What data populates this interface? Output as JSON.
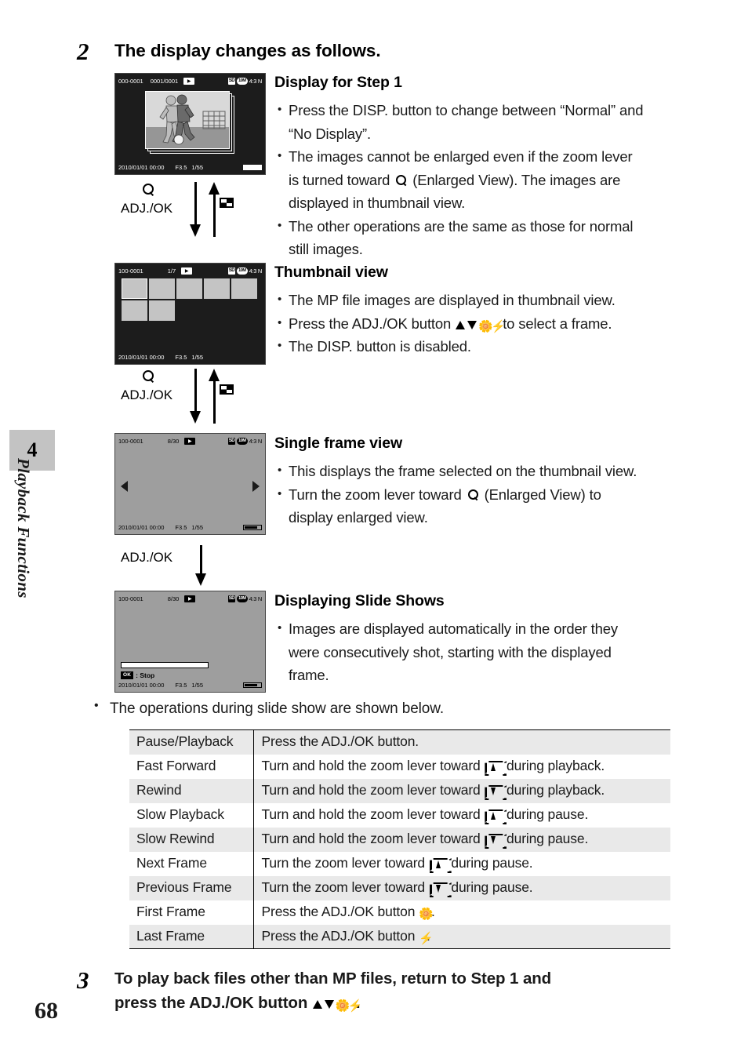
{
  "chapter": {
    "number": "4",
    "label": "Playback Functions",
    "page_number": "68"
  },
  "steps": {
    "step2": {
      "number": "2",
      "title": "The display changes as follows."
    },
    "step3": {
      "number": "3",
      "line1": "To play back files other than MP files, return to Step 1 and",
      "line2_prefix": "press the ADJ./OK button ",
      "line2_suffix": "."
    }
  },
  "screens": {
    "step1_display": {
      "file_no": "000-0001",
      "frame_count": "0001/0001",
      "ratio": "4:3 N",
      "sd_label": "SD",
      "mp_label": "10M",
      "date": "2010/01/01 00:00",
      "aperture": "F3.5",
      "shutter": "1/55"
    },
    "thumbnail": {
      "file_no": "100-0001",
      "frame_count": "1/7",
      "ratio": "4:3 N",
      "sd_label": "SD",
      "mp_label": "10M",
      "date": "2010/01/01 00:00",
      "aperture": "F3.5",
      "shutter": "1/55",
      "thumb_total": 7,
      "selected_index": 0
    },
    "single_frame": {
      "file_no": "100-0001",
      "frame_count": "8/30",
      "ratio": "4:3 N",
      "sd_label": "SD",
      "mp_label": "10M",
      "date": "2010/01/01 00:00",
      "aperture": "F3.5",
      "shutter": "1/55"
    },
    "slide_show": {
      "file_no": "100-0001",
      "frame_count": "8/30",
      "ratio": "4:3 N",
      "sd_label": "SD",
      "mp_label": "10M",
      "date": "2010/01/01 00:00",
      "aperture": "F3.5",
      "shutter": "1/55",
      "ok_key": "OK",
      "stop_label": ": Stop"
    }
  },
  "transitions": {
    "t1": {
      "label": "ADJ./OK"
    },
    "t2": {
      "label": "ADJ./OK"
    },
    "t3": {
      "label": "ADJ./OK"
    }
  },
  "sections": {
    "display_step1": {
      "heading": "Display for Step 1",
      "b1_line1": "Press the DISP. button to change between “Normal” and",
      "b1_line2": "“No Display”.",
      "b2_line1": "The images cannot be enlarged even if the zoom lever",
      "b2_line2_a": "is turned toward ",
      "b2_line2_b": " (Enlarged View). The images are",
      "b2_line3": "displayed in thumbnail view.",
      "b3_line1": "The other operations are the same as those for normal",
      "b3_line2": "still images."
    },
    "thumbnail_view": {
      "heading": "Thumbnail view",
      "b1": "The MP file images are displayed in thumbnail view.",
      "b2_a": "Press the ADJ./OK button ",
      "b2_b": " to select a frame.",
      "b3": "The DISP. button is disabled."
    },
    "single_frame_view": {
      "heading": "Single frame view",
      "b1": "This displays the frame selected on the thumbnail view.",
      "b2_a": "Turn the zoom lever toward ",
      "b2_b": " (Enlarged View) to",
      "b2_line2": "display enlarged view."
    },
    "slide_shows": {
      "heading": "Displaying Slide Shows",
      "b1_line1": "Images are displayed automatically in the order they",
      "b1_line2": "were consecutively shot, starting with the displayed",
      "b1_line3": "frame."
    }
  },
  "operations": {
    "intro": "The operations during slide show are shown below.",
    "rows": [
      {
        "key": "Pause/Playback",
        "before": "Press the ADJ./OK button.",
        "icon": "",
        "after": ""
      },
      {
        "key": "Fast Forward",
        "before": "Turn and hold the zoom lever toward ",
        "icon": "tele",
        "after": " during playback."
      },
      {
        "key": "Rewind",
        "before": "Turn and hold the zoom lever toward ",
        "icon": "wide",
        "after": " during playback."
      },
      {
        "key": "Slow Playback",
        "before": "Turn and hold the zoom lever toward ",
        "icon": "tele",
        "after": " during pause."
      },
      {
        "key": "Slow Rewind",
        "before": "Turn and hold the zoom lever toward ",
        "icon": "wide",
        "after": " during pause."
      },
      {
        "key": "Next Frame",
        "before": "Turn the zoom lever toward ",
        "icon": "tele",
        "after": " during pause."
      },
      {
        "key": "Previous Frame",
        "before": "Turn the zoom lever toward ",
        "icon": "wide",
        "after": " during pause."
      },
      {
        "key": "First Frame",
        "before": "Press the ADJ./OK button ",
        "icon": "macro",
        "after": "."
      },
      {
        "key": "Last Frame",
        "before": "Press the ADJ./OK button ",
        "icon": "flash",
        "after": "."
      }
    ]
  },
  "icons": {
    "magnifier": "magnifier-enlarged-view-icon",
    "thumbnail_grid": "thumbnail-grid-icon",
    "arrow_up": "arrow-up-icon",
    "arrow_down": "arrow-down-icon",
    "macro": "macro-flower-icon",
    "flash": "flash-bolt-icon",
    "zoom_tele": "zoom-lever-telephoto-icon",
    "zoom_wide": "zoom-lever-wide-icon",
    "playback": "playback-triangle-icon"
  }
}
